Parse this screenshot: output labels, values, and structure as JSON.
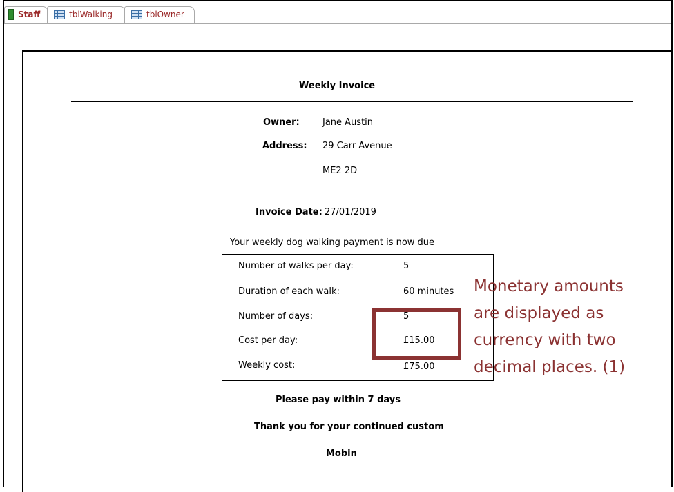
{
  "tabs": [
    {
      "label": "Staff",
      "icon": "form-icon",
      "active": true
    },
    {
      "label": "tblWalking",
      "icon": "table-icon",
      "active": false
    },
    {
      "label": "tblOwner",
      "icon": "table-icon",
      "active": false
    }
  ],
  "report": {
    "title": "Weekly Invoice",
    "owner_label": "Owner:",
    "owner_value": "Jane Austin",
    "address_label": "Address:",
    "address_line1": "29 Carr Avenue",
    "address_line2": "ME2 2D",
    "invoice_date_label": "Invoice Date:",
    "invoice_date_value": "27/01/2019",
    "intro": "Your weekly dog walking payment is now due",
    "details": [
      {
        "label": "Number of walks per day:",
        "value": "5"
      },
      {
        "label": "Duration of each walk:",
        "value": "60 minutes"
      },
      {
        "label": "Number of days:",
        "value": "5"
      },
      {
        "label": "Cost per day:",
        "value": "£15.00"
      },
      {
        "label": "Weekly cost:",
        "value": "£75.00"
      }
    ],
    "pay_note": "Please pay within 7 days",
    "thanks": "Thank you for your continued custom",
    "signature": "Mobin"
  },
  "annotation": {
    "lines": [
      "Monetary amounts",
      "are displayed as",
      "currency with two",
      "decimal places. (1)"
    ],
    "color": "#8b3232"
  }
}
